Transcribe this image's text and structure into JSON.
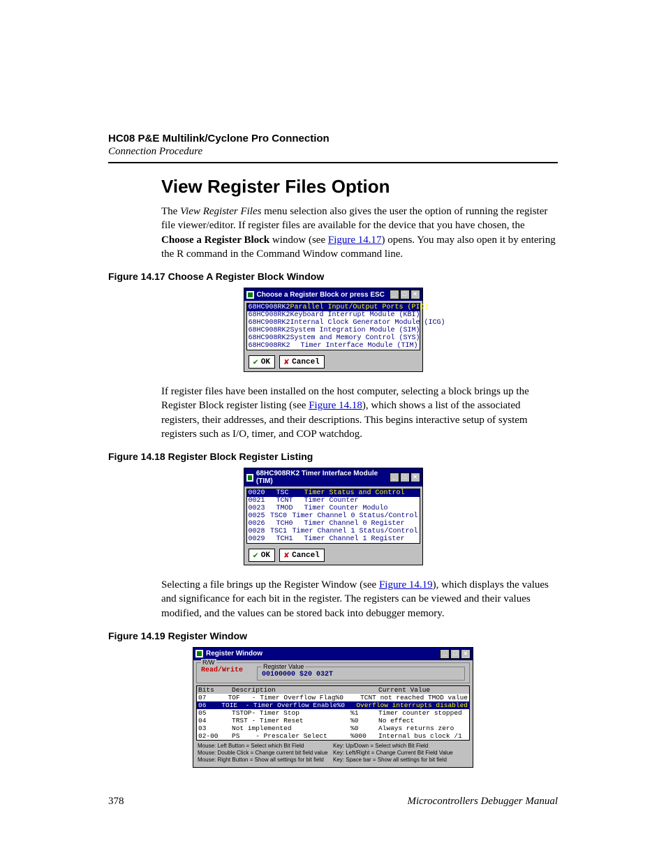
{
  "header": {
    "title": "HC08 P&E Multilink/Cyclone Pro Connection",
    "sub": "Connection Procedure"
  },
  "section_title": "View Register Files Option",
  "para1_a": "The ",
  "para1_italic": "View Register Files",
  "para1_b": " menu selection also gives the user the option of running the register file viewer/editor. If register files are available for the device that you have chosen, the ",
  "para1_bold": "Choose a Register Block",
  "para1_c": " window (see ",
  "para1_link": "Figure 14.17",
  "para1_d": ") opens. You may also open it by entering the R command in the Command Window command line.",
  "fig17_title": "Figure 14.17  Choose A Register Block Window",
  "fig17": {
    "window_title": "Choose a Register Block or press ESC",
    "rows": [
      {
        "c1": "68HC908RK2",
        "c2": "Parallel Input/Output Ports (PIO)",
        "sel": true
      },
      {
        "c1": "68HC908RK2",
        "c2": "Keyboard Interrupt Module (KBI)",
        "sel": false
      },
      {
        "c1": "68HC908RK2",
        "c2": "Internal Clock Generator Module (ICG)",
        "sel": false
      },
      {
        "c1": "68HC908RK2",
        "c2": "System Integration Module (SIM)",
        "sel": false
      },
      {
        "c1": "68HC908RK2",
        "c2": "System and Memory Control (SYS)",
        "sel": false
      },
      {
        "c1": "68HC908RK2",
        "c2": "Timer Interface Module (TIM)",
        "sel": false
      }
    ],
    "ok": "OK",
    "cancel": "Cancel"
  },
  "para2_a": "If register files have been installed on the host computer, selecting a block brings up the Register Block register listing (see ",
  "para2_link": "Figure 14.18",
  "para2_b": "), which shows a list of the associated registers, their addresses, and their descriptions. This begins interactive setup of system registers such as I/O, timer, and COP watchdog.",
  "fig18_title": "Figure 14.18  Register Block Register Listing",
  "fig18": {
    "window_title": "68HC908RK2   Timer Interface Module (TIM)",
    "rows": [
      {
        "a": "0020",
        "r": "TSC",
        "d": "Timer Status and Control",
        "sel": true
      },
      {
        "a": "0021",
        "r": "TCNT",
        "d": "Timer Counter",
        "sel": false
      },
      {
        "a": "0023",
        "r": "TMOD",
        "d": "Timer Counter Modulo",
        "sel": false
      },
      {
        "a": "0025",
        "r": "TSC0",
        "d": "Timer Channel 0 Status/Control",
        "sel": false
      },
      {
        "a": "0026",
        "r": "TCH0",
        "d": "Timer Channel 0 Register",
        "sel": false
      },
      {
        "a": "0028",
        "r": "TSC1",
        "d": "Timer Channel 1 Status/Control",
        "sel": false
      },
      {
        "a": "0029",
        "r": "TCH1",
        "d": "Timer Channel 1 Register",
        "sel": false
      }
    ],
    "ok": "OK",
    "cancel": "Cancel"
  },
  "para3_a": "Selecting a file brings up the Register Window (see ",
  "para3_link": "Figure 14.19",
  "para3_b": "), which displays the values and significance for each bit in the register. The registers can be viewed and their values modified, and the values can be stored back into debugger memory.",
  "fig19_title": "Figure 14.19  Register Window",
  "fig19": {
    "window_title": "Register Window",
    "rw_label": "R/W",
    "rw_value": "Read/Write",
    "rv_label": "Register Value",
    "rv_value": "00100000 $20  032T",
    "hdr_bits": "Bits",
    "hdr_desc": "Description",
    "hdr_cv": "Current Value",
    "rows": [
      {
        "b": "07",
        "d": "TOF   - Timer Overflow Flag",
        "v": "%0",
        "c": "TCNT not reached TMOD value",
        "sel": false
      },
      {
        "b": "06",
        "d": "TOIE  - Timer Overflow Enable",
        "v": "%0",
        "c": "Overflow interrupts disabled",
        "sel": true
      },
      {
        "b": "05",
        "d": "TSTOP- Timer Stop",
        "v": "%1",
        "c": "Timer counter stopped",
        "sel": false
      },
      {
        "b": "04",
        "d": "TRST - Timer Reset",
        "v": "%0",
        "c": "No effect",
        "sel": false
      },
      {
        "b": "03",
        "d": "Not implemented",
        "v": "%0",
        "c": "Always returns zero",
        "sel": false
      },
      {
        "b": "02-00",
        "d": "PS    - Prescaler Select",
        "v": "%000",
        "c": "Internal bus clock /1",
        "sel": false
      }
    ],
    "hints_left": [
      "Mouse: Left Button = Select which Bit Field",
      "Mouse: Double Click = Change current bit field value",
      "Mouse: Right Button = Show all settings for bit field"
    ],
    "hints_right": [
      "Key: Up/Down = Select which Bit Field",
      "Key: Left/Right = Change Current Bit Field Value",
      "Key: Space bar = Show all settings for bit field"
    ]
  },
  "footer": {
    "page": "378",
    "manual": "Microcontrollers Debugger Manual"
  }
}
